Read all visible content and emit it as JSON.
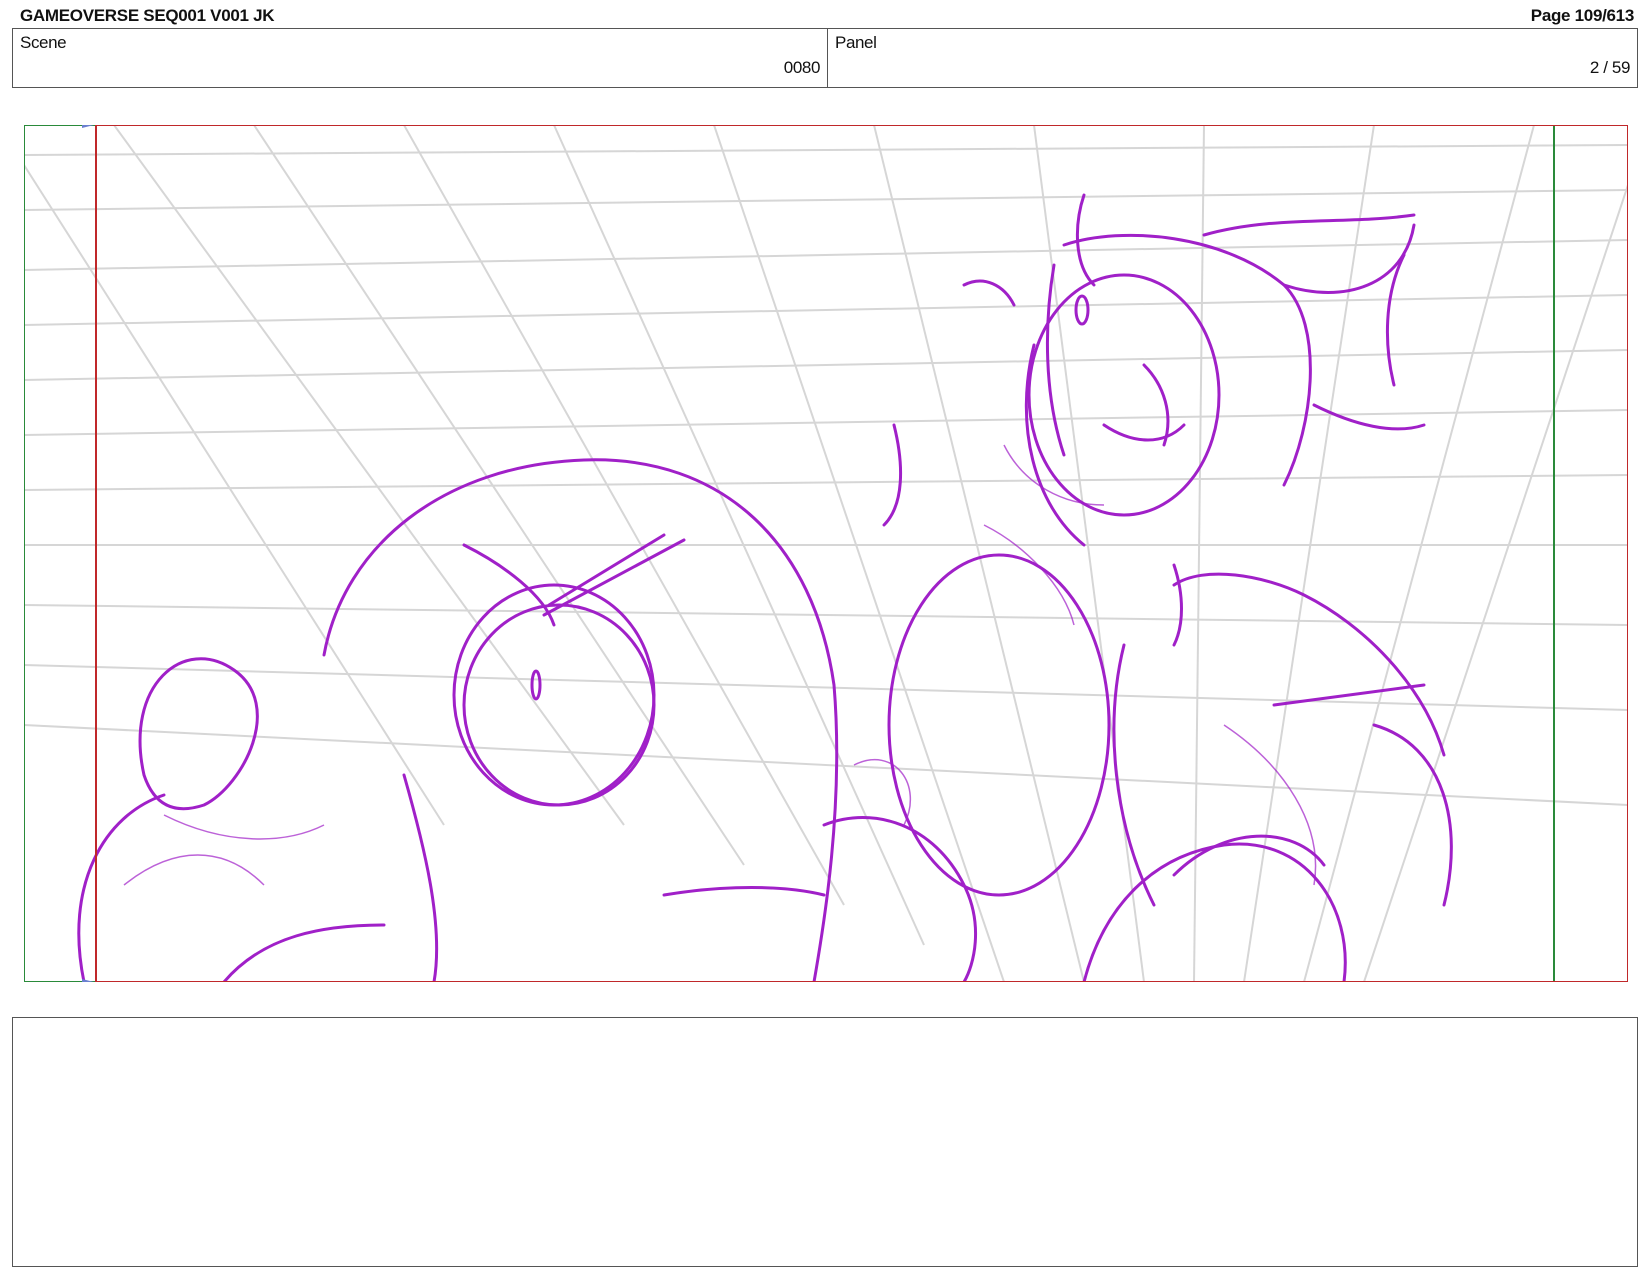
{
  "header": {
    "title": "GAMEOVERSE SEQ001 V001 JK",
    "page": "Page 109/613"
  },
  "info": {
    "scene_label": "Scene",
    "scene_value": "0080",
    "panel_label": "Panel",
    "panel_value": "2 / 59"
  },
  "panel": {
    "sketch_color": "#a020c8",
    "grid_color": "#d6d6d6",
    "safe_frame_color": "#c0282a",
    "action_frame_color": "#2a8a3a"
  },
  "notes": {
    "text": ""
  }
}
